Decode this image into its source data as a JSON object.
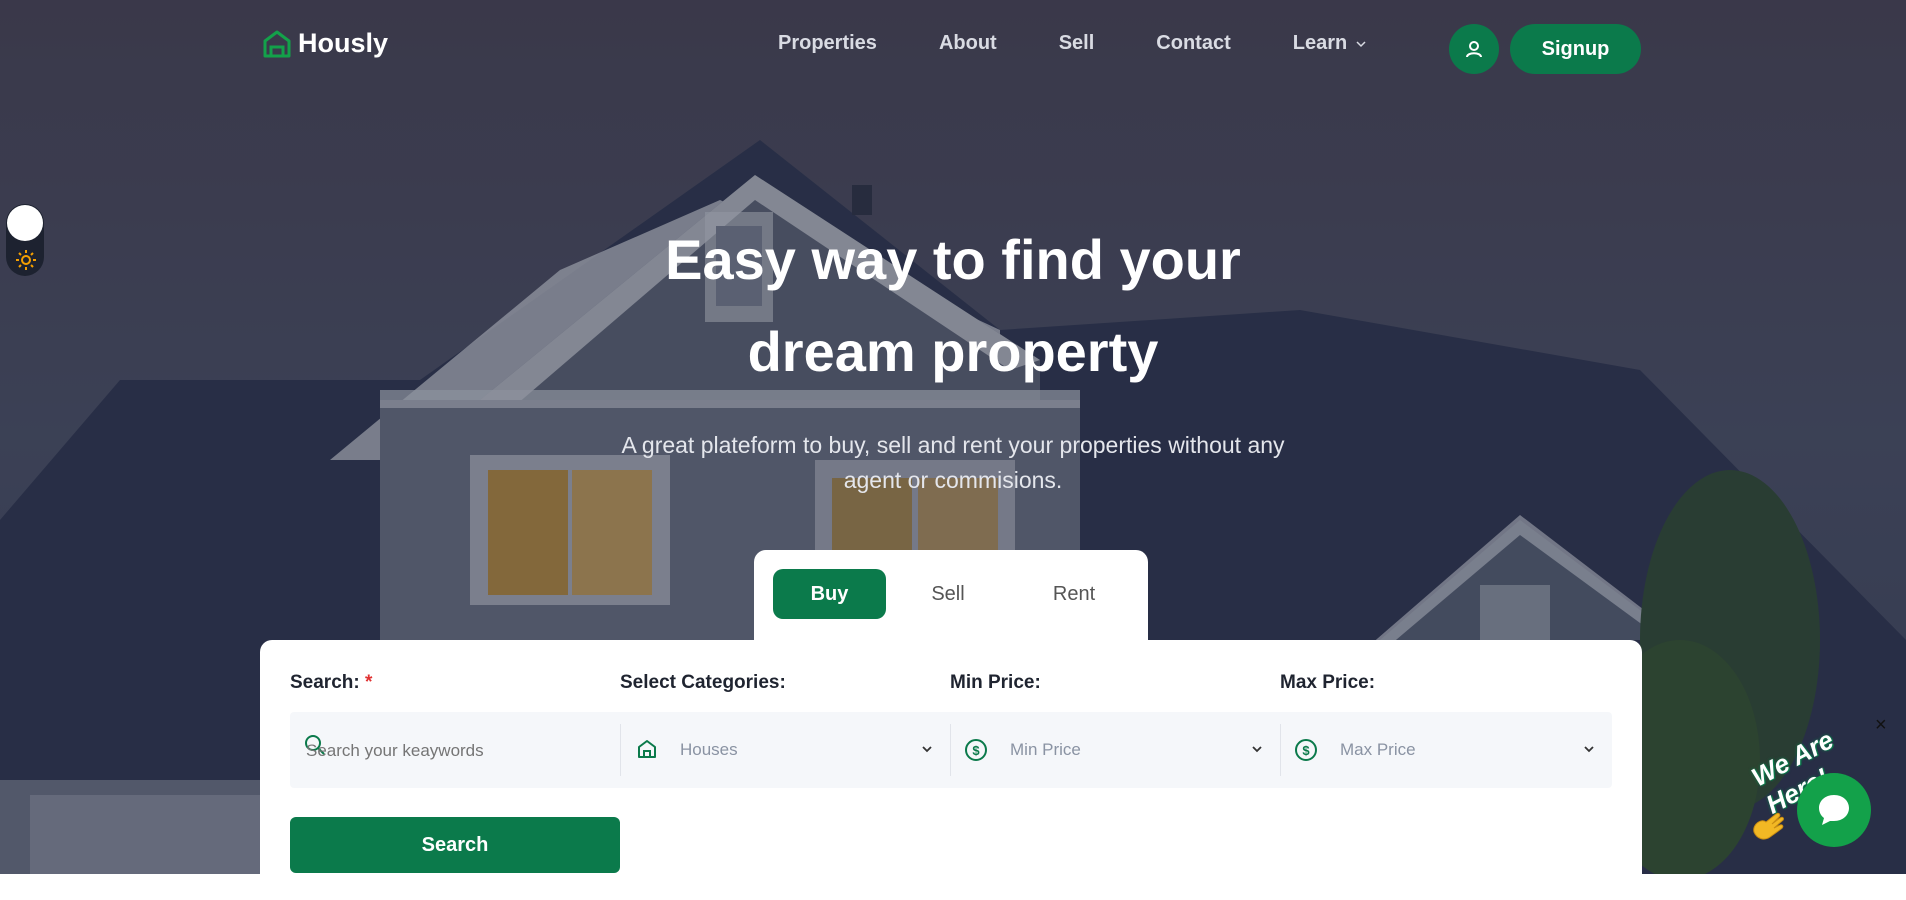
{
  "brand": {
    "name": "Hously"
  },
  "nav": {
    "items": [
      "Properties",
      "About",
      "Sell",
      "Contact",
      "Learn"
    ],
    "signup_label": "Signup"
  },
  "hero": {
    "title_line1": "Easy way to find your",
    "title_line2": "dream property",
    "subtitle_line1": "A great plateform to buy, sell and rent your properties without any",
    "subtitle_line2": "agent or commisions."
  },
  "tabs": {
    "buy": "Buy",
    "sell": "Sell",
    "rent": "Rent",
    "active": "Buy"
  },
  "search": {
    "search_label": "Search:",
    "required_mark": "*",
    "keyword_placeholder": "Search your keaywords",
    "categories_label": "Select Categories:",
    "categories_value": "Houses",
    "min_label": "Min Price:",
    "min_value": "Min Price",
    "max_label": "Max Price:",
    "max_value": "Max Price",
    "button_label": "Search"
  },
  "chat": {
    "tagline": "We Are Here!",
    "close": "×"
  },
  "colors": {
    "accent": "#0b7a4b",
    "chat": "#13a14a"
  }
}
